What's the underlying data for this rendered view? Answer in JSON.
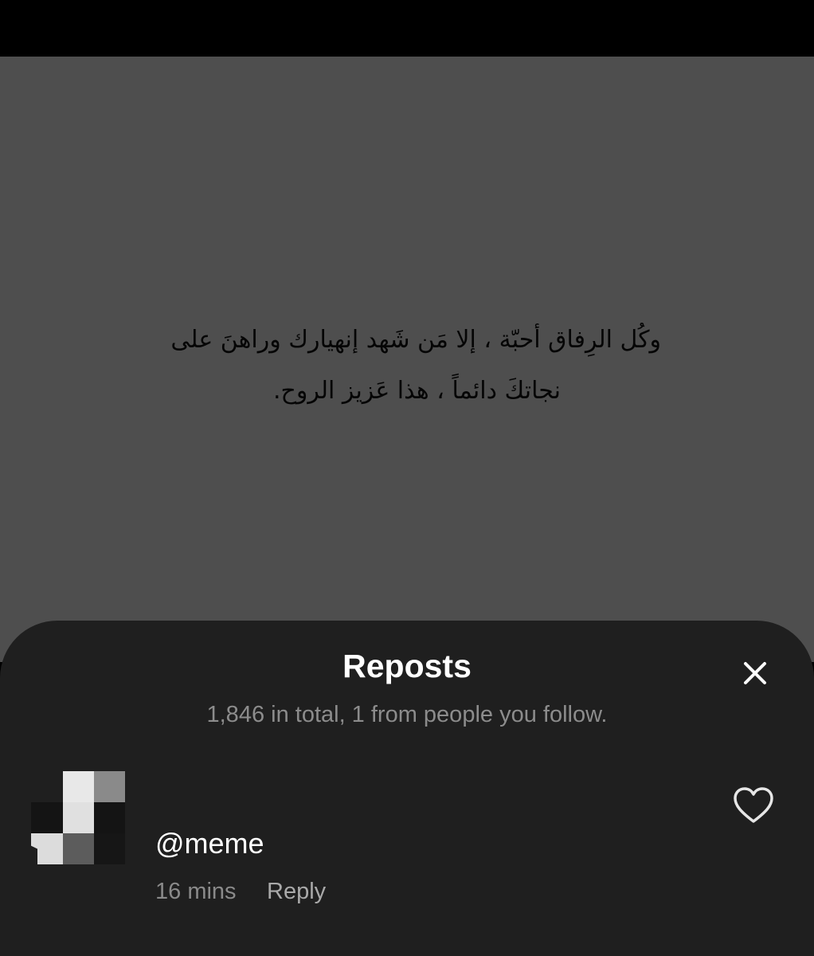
{
  "post": {
    "text_line_1": "وكُل الرِفاق أحبّة ، إلا مَن شَهد إنهيارك وراهنَ على",
    "text_line_2": "نجاتكَ دائماً ، هذا عَزيز الروح."
  },
  "sheet": {
    "title": "Reposts",
    "subtitle": "1,846 in total, 1 from people you follow.",
    "close_icon": "close-icon"
  },
  "reposts": [
    {
      "username": "@meme",
      "time": "16 mins",
      "reply_label": "Reply",
      "like_icon": "heart-outline-icon"
    }
  ],
  "colors": {
    "post_background": "#4e4e4e",
    "sheet_background": "#1f1f1f",
    "subtitle_text": "#8c8c8c",
    "primary_text": "#ffffff"
  }
}
